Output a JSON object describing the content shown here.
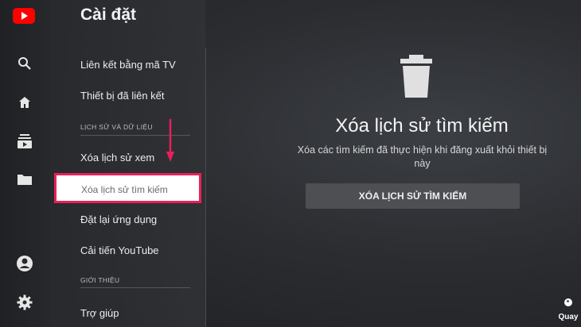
{
  "settings": {
    "title": "Cài đặt",
    "items": [
      "Liên kết bằng mã TV",
      "Thiết bị đã liên kết"
    ],
    "section_history": "LỊCH SỬ VÀ DỮ LIỆU",
    "history_items": [
      "Xóa lịch sử xem",
      "Xóa lịch sử tìm kiếm",
      "Đặt lại ứng dụng",
      "Cải tiến YouTube"
    ],
    "section_about": "GIỚI THIỆU",
    "about_items": [
      "Trợ giúp"
    ]
  },
  "panel": {
    "title": "Xóa lịch sử tìm kiếm",
    "description": "Xóa các tìm kiếm đã thực hiện khi đăng xuất khỏi thiết bị này",
    "button": "XÓA LỊCH SỬ TÌM KIẾM"
  },
  "back_label": "Quay",
  "rail_icons": [
    "youtube-logo",
    "search-icon",
    "home-icon",
    "subscriptions-icon",
    "library-icon",
    "account-icon",
    "settings-icon"
  ],
  "colors": {
    "accent": "#e8205a",
    "brand": "#ff0000"
  }
}
